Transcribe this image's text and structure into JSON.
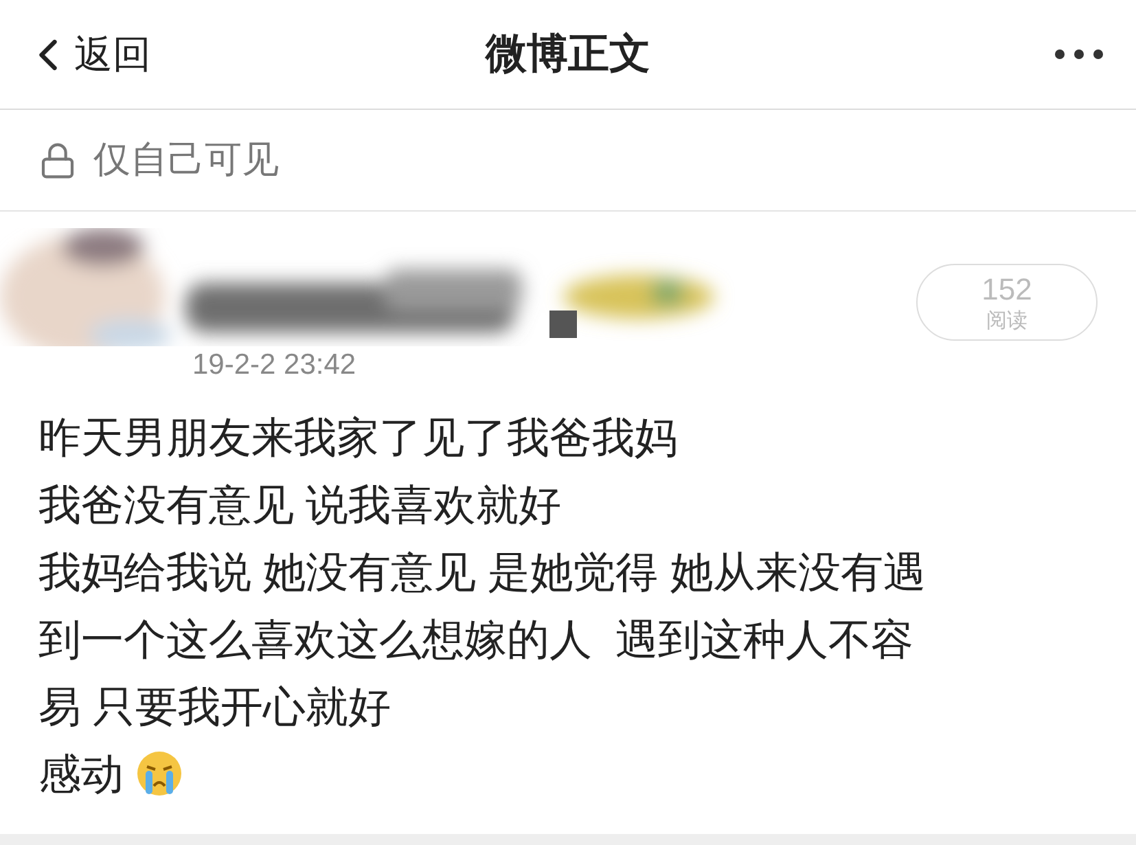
{
  "nav": {
    "back": "返回",
    "title": "微博正文"
  },
  "visibility": {
    "label": "仅自己可见"
  },
  "post": {
    "time": "19-2-2 23:42",
    "reads": {
      "count": "152",
      "label": "阅读"
    },
    "lines": [
      "昨天男朋友来我家了见了我爸我妈",
      "我爸没有意见 说我喜欢就好",
      "我妈给我说 她没有意见 是她觉得 她从来没有遇",
      "到一个这么喜欢这么想嫁的人  遇到这种人不容",
      "易 只要我开心就好",
      "感动"
    ]
  }
}
